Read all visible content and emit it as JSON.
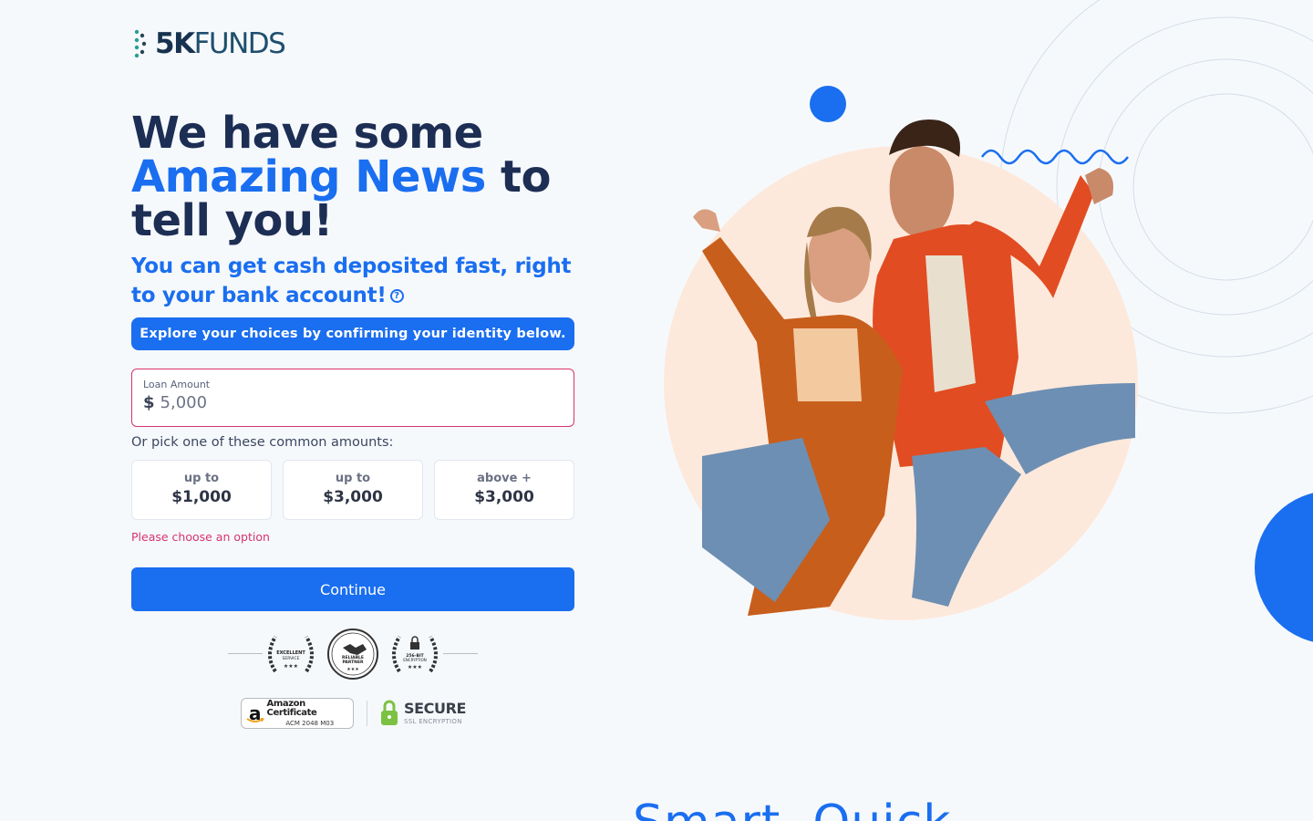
{
  "brand": {
    "logo_bold": "5K",
    "logo_rest": "FUNDS"
  },
  "headline": {
    "line1": "We have some",
    "accent": "Amazing News",
    "line2_rest": " to",
    "line3": "tell you!"
  },
  "subheadline": {
    "text": "You can get cash deposited fast, right to your bank account!",
    "help_icon": "question-circle-icon"
  },
  "banner": {
    "text": "Explore your choices by confirming your identity below."
  },
  "loan_amount": {
    "label": "Loan Amount",
    "currency_symbol": "$",
    "placeholder": "5,000"
  },
  "common_amounts": {
    "prompt": "Or pick one of these common amounts:",
    "options": [
      {
        "prefix": "up to",
        "value": "$1,000"
      },
      {
        "prefix": "up to",
        "value": "$3,000"
      },
      {
        "prefix": "above +",
        "value": "$3,000"
      }
    ],
    "error": "Please choose an option"
  },
  "continue_button": {
    "label": "Continue"
  },
  "badges": [
    {
      "lines": [
        "EXCELLENT",
        "SERVICE"
      ],
      "icon": "laurel-wreath-icon"
    },
    {
      "lines": [
        "RELIABLE",
        "PARTNER"
      ],
      "icon": "handshake-icon"
    },
    {
      "lines": [
        "256-BIT",
        "ENCRYPTION"
      ],
      "icon": "lock-icon"
    }
  ],
  "trust": {
    "amazon_title": "Amazon Certificate",
    "amazon_sub": "ACM 2048 M03",
    "secure_title": "SECURE",
    "secure_sub": "SSL ENCRYPTION"
  },
  "next_section": {
    "heading": "Smart, Quick"
  },
  "colors": {
    "accent": "#1a6ef0",
    "navy": "#1d2e54",
    "error": "#d6336c",
    "hero_circle": "#fde9dc"
  }
}
